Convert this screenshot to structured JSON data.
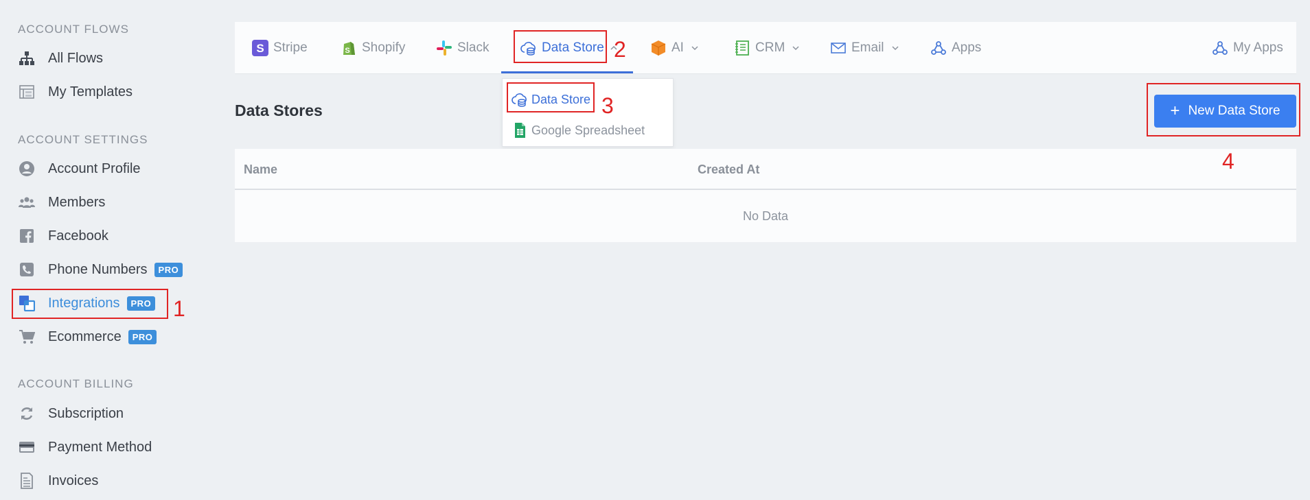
{
  "sidebar": {
    "sections": [
      {
        "title": "ACCOUNT FLOWS",
        "items": [
          {
            "label": "All Flows",
            "icon": "sitemap-icon"
          },
          {
            "label": "My Templates",
            "icon": "template-icon"
          }
        ]
      },
      {
        "title": "ACCOUNT SETTINGS",
        "items": [
          {
            "label": "Account Profile",
            "icon": "user-circle-icon"
          },
          {
            "label": "Members",
            "icon": "users-icon"
          },
          {
            "label": "Facebook",
            "icon": "facebook-icon"
          },
          {
            "label": "Phone Numbers",
            "icon": "phone-icon",
            "badge": "PRO"
          },
          {
            "label": "Integrations",
            "icon": "integrations-icon",
            "badge": "PRO",
            "active": true
          },
          {
            "label": "Ecommerce",
            "icon": "cart-icon",
            "badge": "PRO"
          }
        ]
      },
      {
        "title": "ACCOUNT BILLING",
        "items": [
          {
            "label": "Subscription",
            "icon": "refresh-icon"
          },
          {
            "label": "Payment Method",
            "icon": "credit-card-icon"
          },
          {
            "label": "Invoices",
            "icon": "invoice-icon"
          }
        ]
      }
    ]
  },
  "tabs": [
    {
      "label": "Stripe",
      "icon": "stripe-icon"
    },
    {
      "label": "Shopify",
      "icon": "shopify-icon"
    },
    {
      "label": "Slack",
      "icon": "slack-icon"
    },
    {
      "label": "Data Store",
      "icon": "cloud-database-icon",
      "active": true,
      "chevron": "up"
    },
    {
      "label": "AI",
      "icon": "ai-cube-icon",
      "chevron": "down"
    },
    {
      "label": "CRM",
      "icon": "crm-icon",
      "chevron": "down"
    },
    {
      "label": "Email",
      "icon": "envelope-icon",
      "chevron": "down"
    },
    {
      "label": "Apps",
      "icon": "webhook-icon"
    },
    {
      "label": "My Apps",
      "icon": "webhook-icon"
    }
  ],
  "dropdown": {
    "items": [
      {
        "label": "Data Store",
        "icon": "cloud-database-icon",
        "active": true
      },
      {
        "label": "Google Spreadsheet",
        "icon": "google-sheets-icon"
      }
    ]
  },
  "main": {
    "title": "Data Stores",
    "new_button": "New Data Store",
    "table": {
      "columns": [
        "Name",
        "Created At"
      ],
      "empty_text": "No Data"
    }
  },
  "annotations": [
    "1",
    "2",
    "3",
    "4"
  ],
  "colors": {
    "accent": "#3b7ff0",
    "active_link": "#3c8ddb",
    "annotation": "#e02424",
    "pro_badge": "#3d8fdb"
  }
}
